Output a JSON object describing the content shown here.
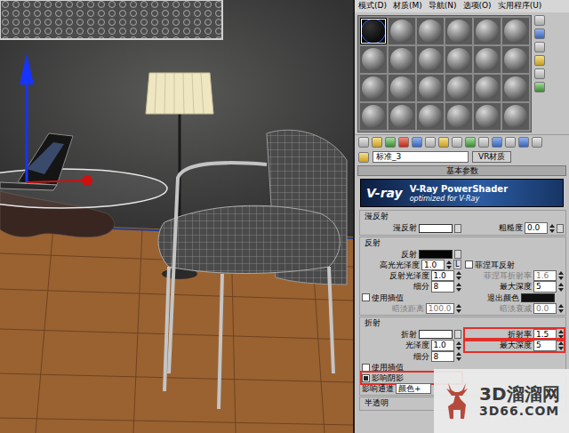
{
  "menu": [
    {
      "label": "模式(D)"
    },
    {
      "label": "材质(M)"
    },
    {
      "label": "导航(N)"
    },
    {
      "label": "选项(O)"
    },
    {
      "label": "实用程序(U)"
    }
  ],
  "swatches": [
    {
      "selected": true
    },
    {
      "selected": false
    },
    {
      "selected": false
    },
    {
      "selected": false
    },
    {
      "selected": false
    },
    {
      "selected": false
    },
    {
      "selected": false
    },
    {
      "selected": false
    },
    {
      "selected": false
    },
    {
      "selected": false
    },
    {
      "selected": false
    },
    {
      "selected": false
    },
    {
      "selected": false
    },
    {
      "selected": false
    },
    {
      "selected": false
    },
    {
      "selected": false
    },
    {
      "selected": false
    },
    {
      "selected": false
    },
    {
      "selected": false
    },
    {
      "selected": false
    },
    {
      "selected": false
    },
    {
      "selected": false
    },
    {
      "selected": false
    },
    {
      "selected": false
    }
  ],
  "material": {
    "name": "标准_3",
    "type": "VR材质"
  },
  "rollout": {
    "title": "基本参数"
  },
  "banner": {
    "logo": "V-ray",
    "title": "V-Ray PowerShader",
    "subtitle": "optimized for V-Ray"
  },
  "sections": [
    {
      "title": "漫反射",
      "rows": [
        [
          {
            "kind": "swatch",
            "label": "漫反射",
            "color": "#ffffff",
            "map": true
          },
          {
            "kind": "spinner",
            "label": "粗糙度",
            "value": "0.0",
            "disabled": false,
            "highlighted": false,
            "lock": "",
            "map": true
          }
        ]
      ]
    },
    {
      "title": "反射",
      "rows": [
        [
          {
            "kind": "swatch",
            "label": "反射",
            "color": "#050505",
            "map": true
          },
          null
        ],
        [
          {
            "kind": "spinner",
            "label": "高光光泽度",
            "value": "1.0",
            "disabled": false,
            "highlighted": false,
            "lock": "L",
            "map": false
          },
          {
            "kind": "check",
            "label": "菲涅耳反射",
            "checked": false,
            "highlighted": false
          }
        ],
        [
          {
            "kind": "spinner",
            "label": "反射光泽度",
            "value": "1.0",
            "disabled": false,
            "highlighted": false,
            "lock": "",
            "map": false
          },
          {
            "kind": "spinner",
            "label": "菲涅耳折射率",
            "value": "1.6",
            "disabled": true,
            "highlighted": false,
            "lock": "",
            "map": false
          }
        ],
        [
          {
            "kind": "spinner",
            "label": "细分",
            "value": "8",
            "disabled": false,
            "highlighted": false,
            "lock": "",
            "map": false
          },
          {
            "kind": "spinner",
            "label": "最大深度",
            "value": "5",
            "disabled": false,
            "highlighted": false,
            "lock": "",
            "map": false
          }
        ],
        [
          {
            "kind": "check",
            "label": "使用插值",
            "checked": false,
            "highlighted": false
          },
          {
            "kind": "swatch",
            "label": "退出颜色",
            "color": "#101010",
            "map": false
          }
        ],
        [
          {
            "kind": "spinner",
            "label": "暗淡距离",
            "value": "100.0",
            "disabled": true,
            "highlighted": false,
            "lock": "",
            "map": false
          },
          {
            "kind": "spinner",
            "label": "暗淡衰减",
            "value": "0.0",
            "disabled": true,
            "highlighted": false,
            "lock": "",
            "map": false
          }
        ]
      ]
    },
    {
      "title": "折射",
      "rows": [
        [
          {
            "kind": "swatch",
            "label": "折射",
            "color": "#ffffff",
            "map": true
          },
          {
            "kind": "spinner",
            "label": "折射率",
            "value": "1.5",
            "disabled": false,
            "highlighted": true,
            "lock": "",
            "map": false
          }
        ],
        [
          {
            "kind": "spinner",
            "label": "光泽度",
            "value": "1.0",
            "disabled": false,
            "highlighted": false,
            "lock": "",
            "map": false
          },
          {
            "kind": "spinner",
            "label": "最大深度",
            "value": "5",
            "disabled": false,
            "highlighted": true,
            "lock": "",
            "map": false
          }
        ],
        [
          {
            "kind": "spinner",
            "label": "细分",
            "value": "8",
            "disabled": false,
            "highlighted": false,
            "lock": "",
            "map": false
          },
          null
        ],
        [
          {
            "kind": "check",
            "label": "使用插值",
            "checked": false,
            "highlighted": false
          },
          null
        ],
        [
          {
            "kind": "check",
            "label": "影响阴影",
            "checked": true,
            "highlighted": true
          },
          null
        ],
        [
          {
            "kind": "select",
            "label": "影响通道",
            "value": "颜色+"
          },
          null
        ]
      ]
    },
    {
      "title": "半透明",
      "rows": []
    }
  ],
  "watermark": {
    "name": "3D溜溜网",
    "url": "3D66.COM"
  }
}
